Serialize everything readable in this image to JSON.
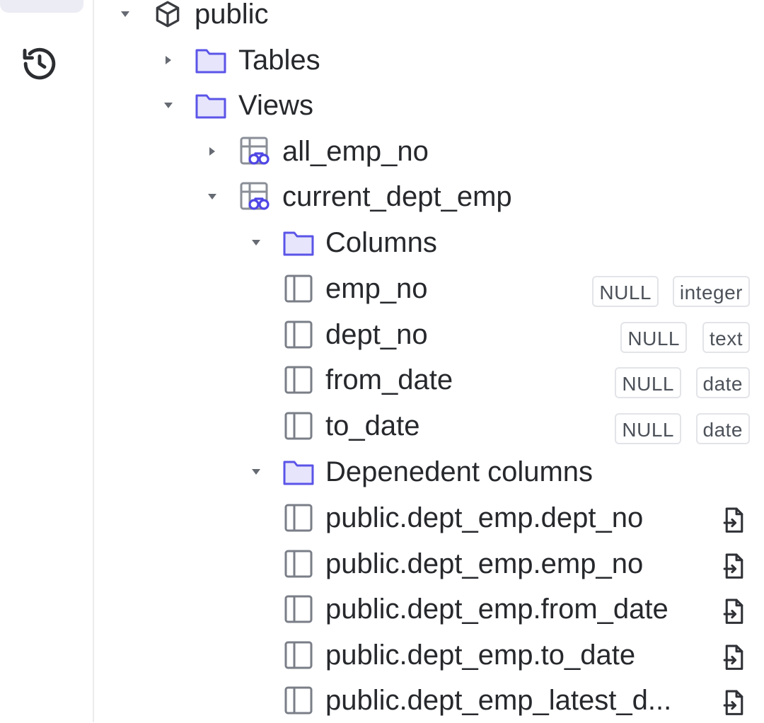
{
  "tree": {
    "schema": {
      "label": "public"
    },
    "tables_folder": {
      "label": "Tables"
    },
    "views_folder": {
      "label": "Views"
    },
    "views": [
      {
        "label": "all_emp_no"
      },
      {
        "label": "current_dept_emp"
      }
    ],
    "columns_folder": {
      "label": "Columns"
    },
    "columns": [
      {
        "name": "emp_no",
        "nullable": "NULL",
        "type": "integer"
      },
      {
        "name": "dept_no",
        "nullable": "NULL",
        "type": "text"
      },
      {
        "name": "from_date",
        "nullable": "NULL",
        "type": "date"
      },
      {
        "name": "to_date",
        "nullable": "NULL",
        "type": "date"
      }
    ],
    "dependent_folder": {
      "label": "Depenedent columns"
    },
    "dependent_columns": [
      {
        "name": "public.dept_emp.dept_no"
      },
      {
        "name": "public.dept_emp.emp_no"
      },
      {
        "name": "public.dept_emp.from_date"
      },
      {
        "name": "public.dept_emp.to_date"
      },
      {
        "name": "public.dept_emp_latest_d..."
      }
    ]
  },
  "colors": {
    "folder_stroke": "#5b54e8",
    "folder_fill": "#e6e5fb",
    "icon_gray": "#6b6f78",
    "caret": "#666a72"
  },
  "icons": {
    "rail": "history-icon",
    "schema": "cube-icon",
    "folder": "folder-icon",
    "view": "view-icon",
    "column": "column-icon",
    "goto": "goto-icon"
  }
}
